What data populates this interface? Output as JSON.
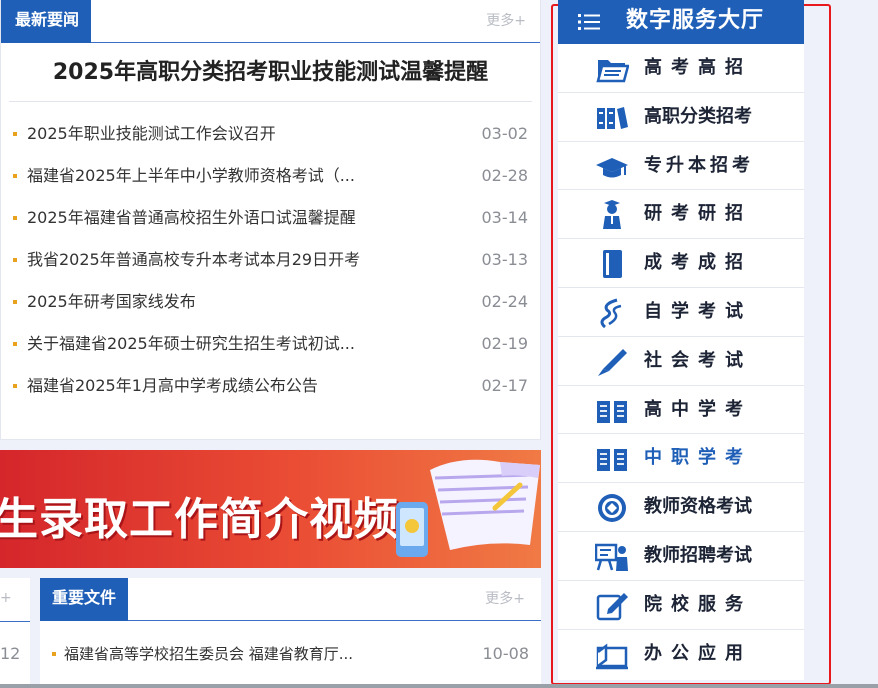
{
  "news": {
    "tab_label": "最新要闻",
    "more_label": "更多+",
    "headline": "2025年高职分类招考职业技能测试温馨提醒",
    "items": [
      {
        "title": "2025年职业技能测试工作会议召开",
        "date": "03-02"
      },
      {
        "title": "福建省2025年上半年中小学教师资格考试（...",
        "date": "02-28"
      },
      {
        "title": "2025年福建省普通高校招生外语口试温馨提醒",
        "date": "03-14"
      },
      {
        "title": "我省2025年普通高校专升本考试本月29日开考",
        "date": "03-13"
      },
      {
        "title": "2025年研考国家线发布",
        "date": "02-24"
      },
      {
        "title": "关于福建省2025年硕士研究生招生考试初试...",
        "date": "02-19"
      },
      {
        "title": "福建省2025年1月高中学考成绩公布公告",
        "date": "02-17"
      }
    ]
  },
  "banner": {
    "text": "生录取工作简介视频"
  },
  "mini_panel": {
    "more_label": "+",
    "date": "12"
  },
  "files": {
    "tab_label": "重要文件",
    "more_label": "更多+",
    "items": [
      {
        "title": "福建省高等学校招生委员会 福建省教育厅...",
        "date": "10-08"
      }
    ]
  },
  "hall": {
    "title": "数字服务大厅",
    "items": [
      {
        "label": "高考高招",
        "icon": "folder-icon"
      },
      {
        "label": "高职分类招考",
        "icon": "books-icon"
      },
      {
        "label": "专升本招考",
        "icon": "graduation-cap-icon"
      },
      {
        "label": "研考研招",
        "icon": "graduate-person-icon"
      },
      {
        "label": "成考成招",
        "icon": "book-icon"
      },
      {
        "label": "自学考试",
        "icon": "swirl-logo-icon"
      },
      {
        "label": "社会考试",
        "icon": "pen-icon"
      },
      {
        "label": "高中学考",
        "icon": "open-book-icon"
      },
      {
        "label": "中职学考",
        "icon": "open-book-icon"
      },
      {
        "label": "教师资格考试",
        "icon": "seal-icon"
      },
      {
        "label": "教师招聘考试",
        "icon": "teacher-board-icon"
      },
      {
        "label": "院校服务",
        "icon": "edit-icon"
      },
      {
        "label": "办公应用",
        "icon": "office-icon"
      }
    ]
  },
  "colors": {
    "brand_blue": "#1f5fb7",
    "highlight_red": "#e8191c",
    "bullet_orange": "#e8a21e",
    "icon_blue": "#1f5fb7"
  }
}
